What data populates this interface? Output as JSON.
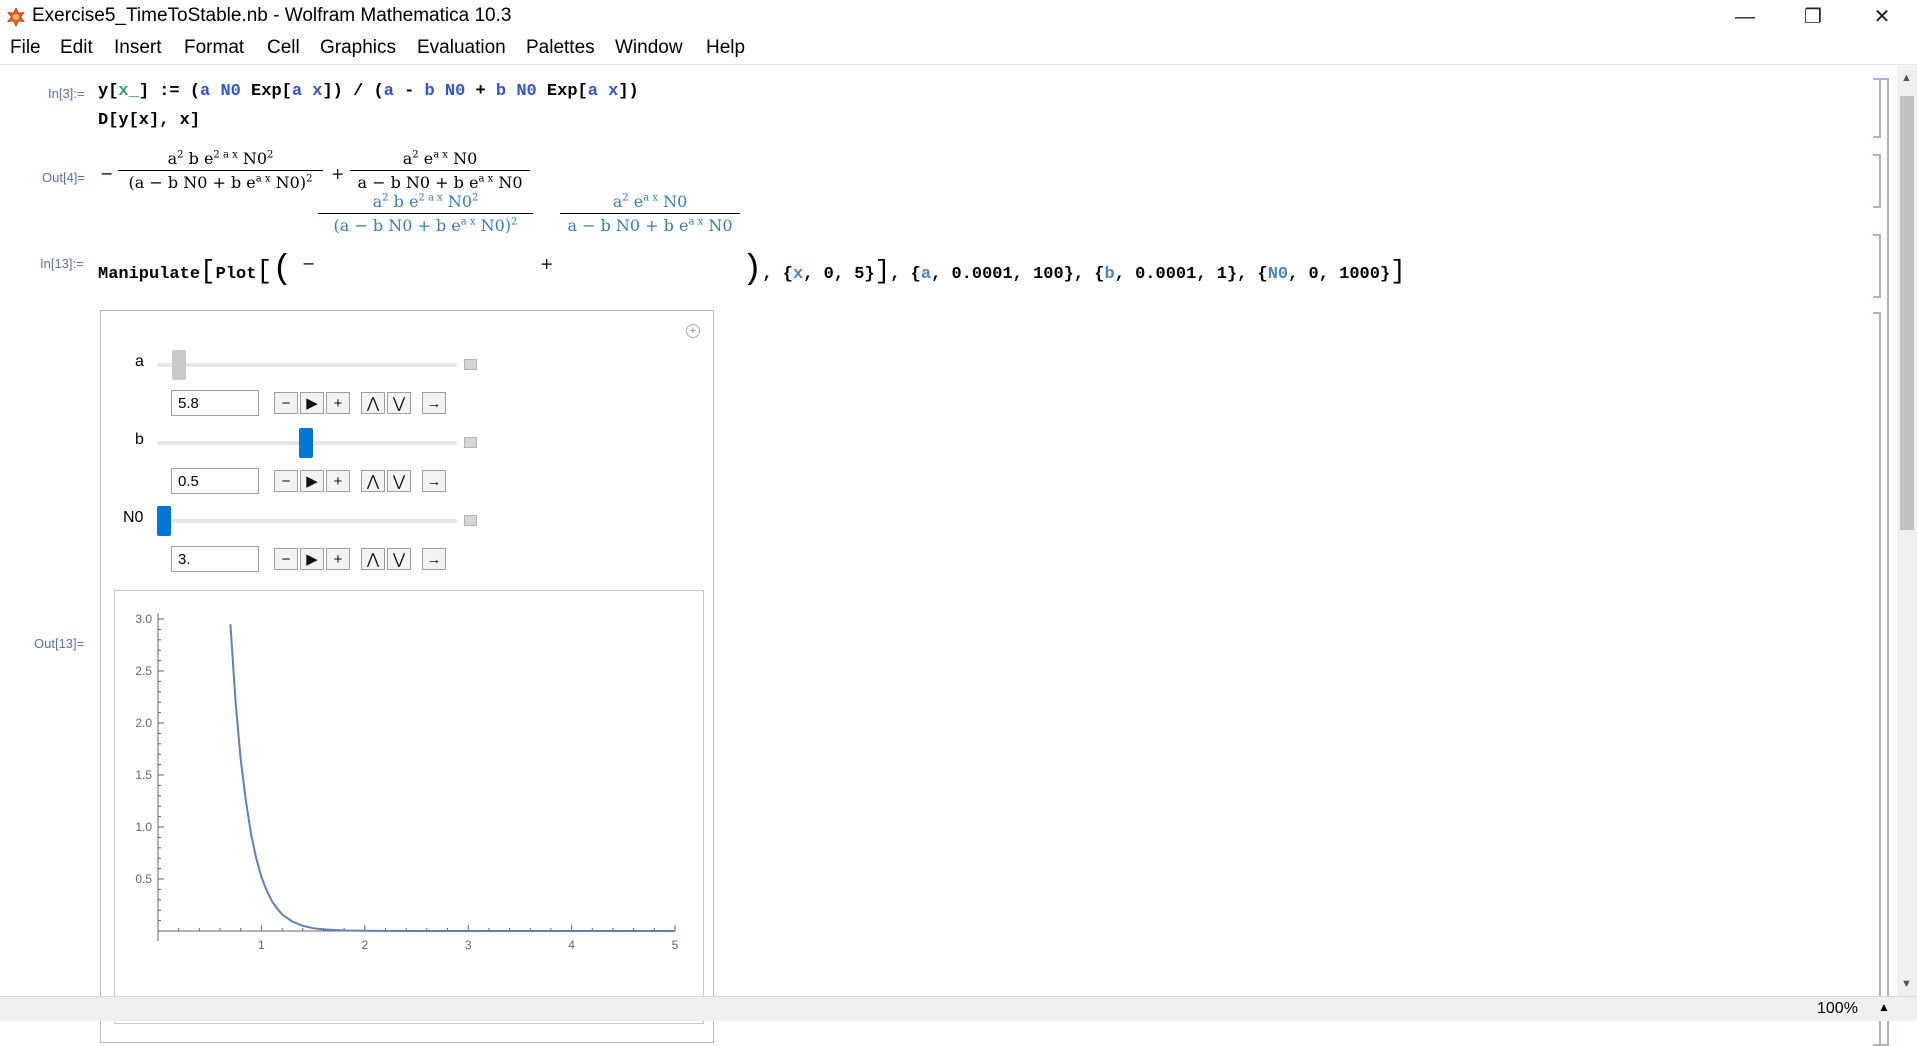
{
  "window": {
    "title": "Exercise5_TimeToStable.nb - Wolfram Mathematica 10.3",
    "minimize": "—",
    "restore": "❐",
    "close": "✕"
  },
  "menu": [
    "File",
    "Edit",
    "Insert",
    "Format",
    "Cell",
    "Graphics",
    "Evaluation",
    "Palettes",
    "Window",
    "Help"
  ],
  "cells": {
    "in3_label": "In[3]:=",
    "in3_line1": "y[x_] := (a N0 Exp[a x]) / (a - b N0 + b N0 Exp[a x])",
    "in3_line2": "D[y[x], x]",
    "out4_label": "Out[4]=",
    "in13_label": "In[13]:=",
    "out13_label": "Out[13]="
  },
  "manipulate": {
    "controls": [
      {
        "name": "a",
        "value": "5.8",
        "position": 0.058
      },
      {
        "name": "b",
        "value": "0.5",
        "position": 0.5
      },
      {
        "name": "N0",
        "value": "3.",
        "position": 0.003
      }
    ],
    "buttons": {
      "minus": "−",
      "play": "▶",
      "plus": "+",
      "faster": "⋀",
      "slower": "⋁",
      "direction": "→"
    }
  },
  "chart_data": {
    "type": "line",
    "title": "",
    "xlabel": "",
    "ylabel": "",
    "xlim": [
      0,
      5
    ],
    "ylim": [
      0,
      3.0
    ],
    "xticks": [
      "1",
      "2",
      "3",
      "4",
      "5"
    ],
    "yticks": [
      "0.5",
      "1.0",
      "1.5",
      "2.0",
      "2.5",
      "3.0"
    ],
    "series": [
      {
        "color": "#5e81b5",
        "x": [
          0.7,
          0.75,
          0.8,
          0.85,
          0.9,
          0.95,
          1.0,
          1.05,
          1.1,
          1.15,
          1.2,
          1.3,
          1.4,
          1.5,
          1.6,
          1.8,
          2.0,
          2.5,
          3.0,
          4.0,
          5.0
        ],
        "y": [
          2.95,
          2.2,
          1.65,
          1.25,
          0.93,
          0.7,
          0.52,
          0.39,
          0.29,
          0.22,
          0.16,
          0.09,
          0.05,
          0.027,
          0.015,
          0.005,
          0.002,
          0.0,
          0.0,
          0.0,
          0.0
        ]
      }
    ]
  },
  "status": {
    "zoom": "100%"
  }
}
